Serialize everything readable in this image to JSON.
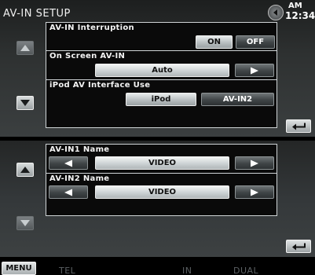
{
  "header": {
    "title": "AV-IN SETUP",
    "clock": {
      "ampm": "AM",
      "time": "12:34"
    }
  },
  "panel1": {
    "rows": [
      {
        "label": "AV-IN Interruption",
        "options": [
          "ON",
          "OFF"
        ],
        "selected": "ON"
      },
      {
        "label": "On Screen AV-IN",
        "value": "Auto"
      },
      {
        "label": "iPod AV Interface Use",
        "options": [
          "iPod",
          "AV-IN2"
        ],
        "selected": "iPod"
      }
    ]
  },
  "panel2": {
    "rows": [
      {
        "label": "AV-IN1 Name",
        "value": "VIDEO"
      },
      {
        "label": "AV-IN2 Name",
        "value": "VIDEO"
      }
    ]
  },
  "bottom_bar": {
    "menu_label": "MENU",
    "items": [
      "TEL",
      "IN",
      "DUAL"
    ]
  },
  "icons": {
    "scroll_up": "triangle-up-icon",
    "scroll_down": "triangle-down-icon",
    "return": "return-arrow-icon",
    "prev": "left-triangle-icon",
    "next": "right-triangle-icon",
    "language": "globe-icon"
  }
}
